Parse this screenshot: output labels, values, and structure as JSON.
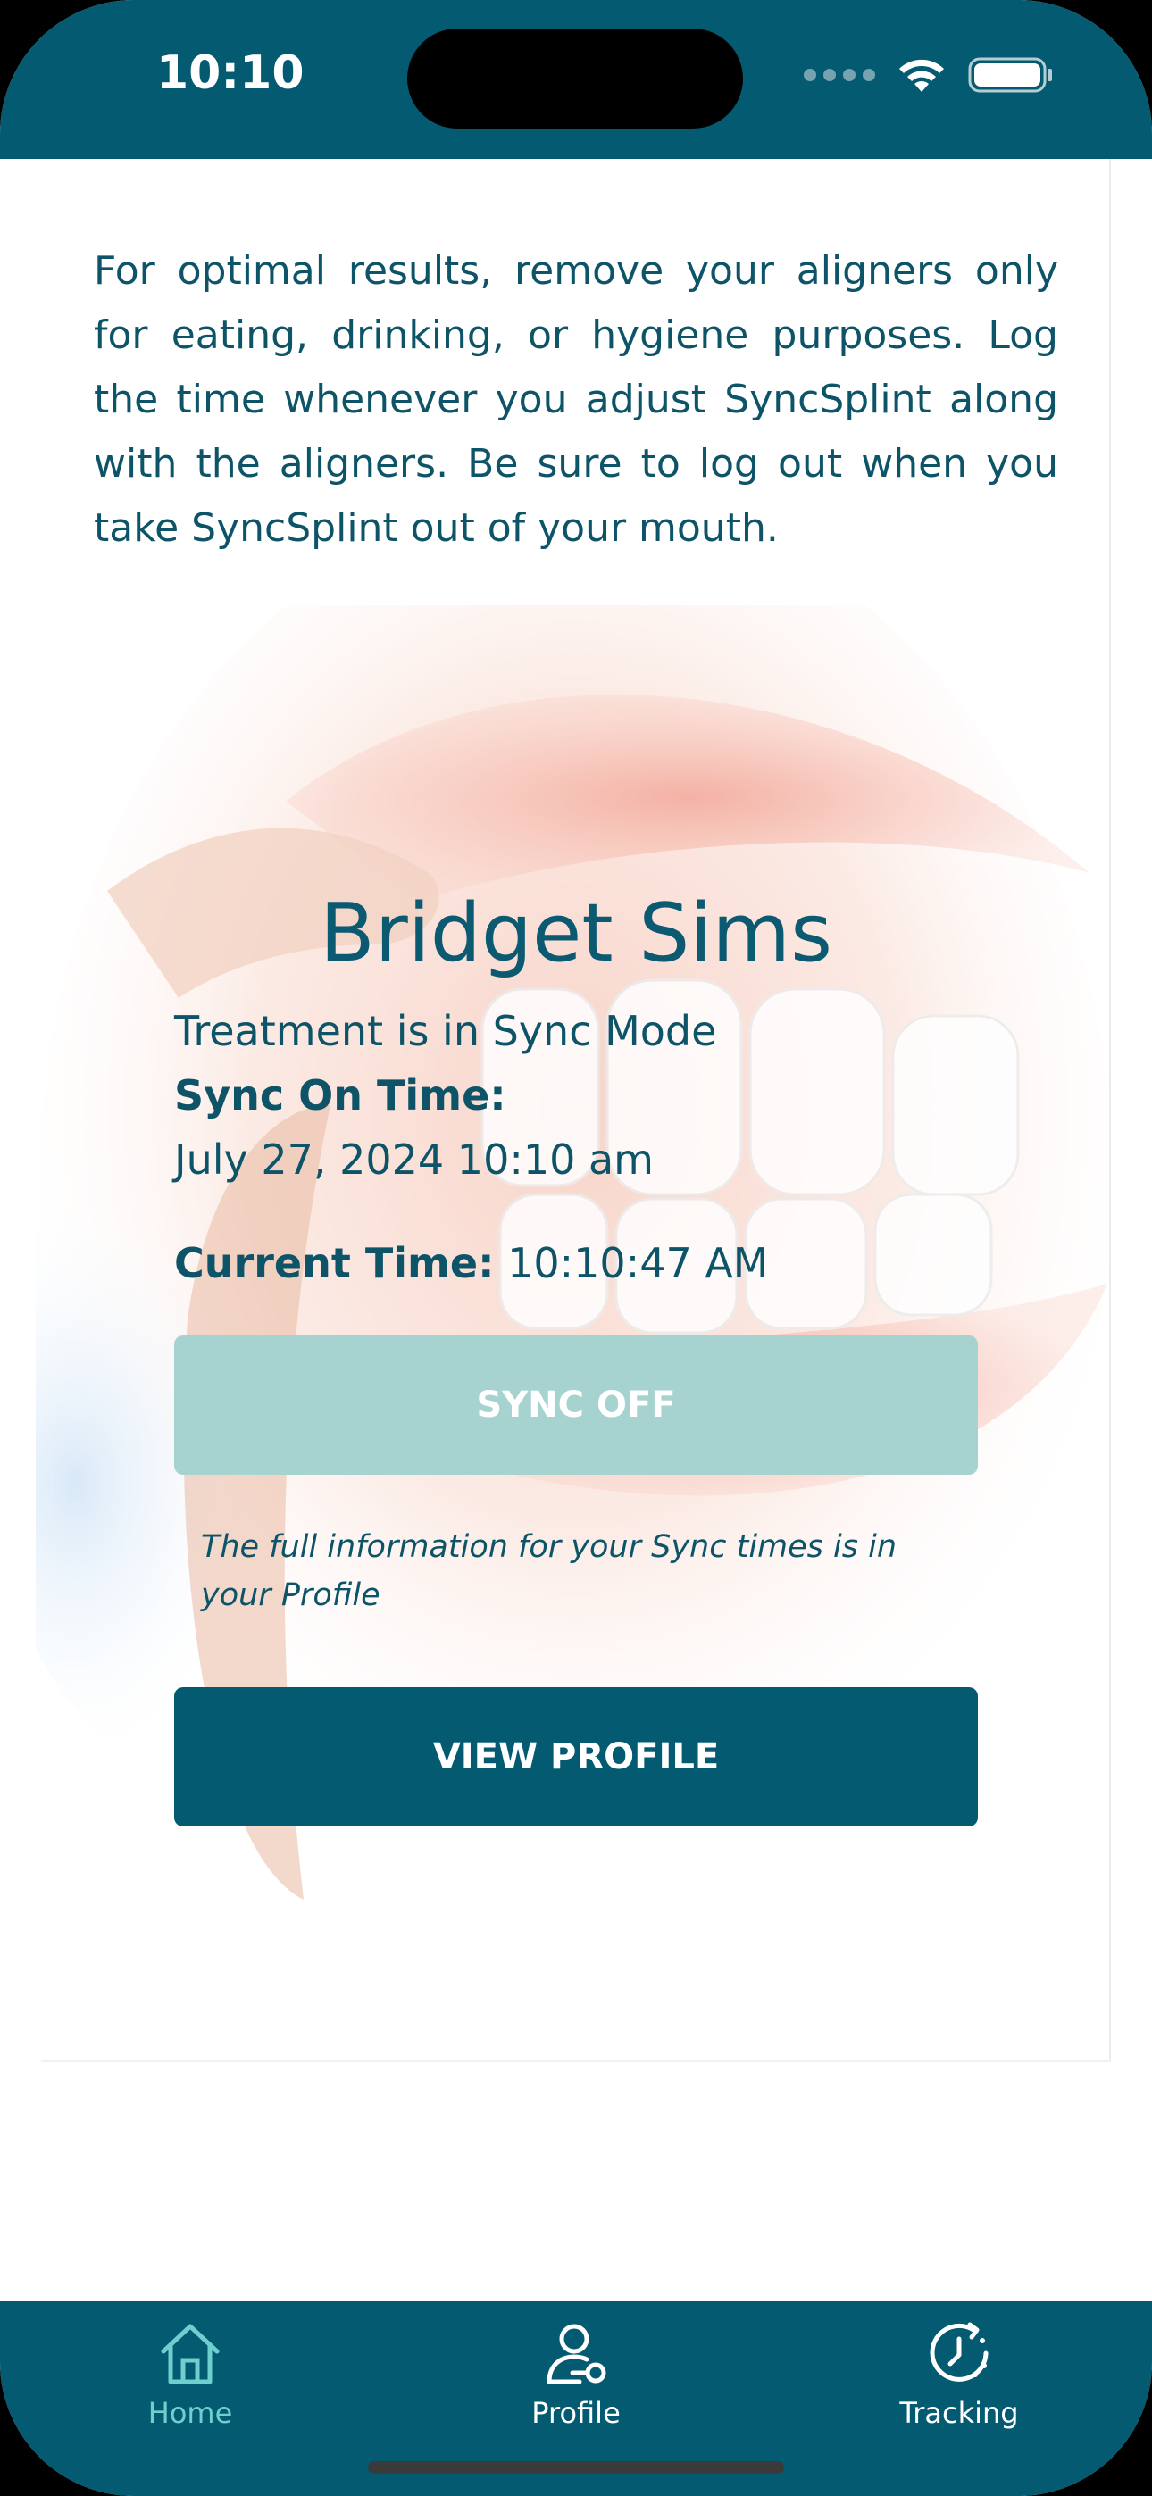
{
  "status_bar": {
    "time": "10:10",
    "icons": [
      "cellular-signal-icon",
      "wifi-icon",
      "battery-icon"
    ]
  },
  "intro": {
    "text": "For optimal results, remove your aligners only for eating, drinking, or hygiene purposes. Log the time whenever you adjust SyncSplint along with the aligners. Be sure to log out when you take SyncSplint out of your mouth."
  },
  "patient": {
    "name": "Bridget Sims",
    "treatment_status": "Treatment is in Sync Mode",
    "sync_on_label": "Sync On Time:",
    "sync_on_value": "July 27, 2024 10:10 am",
    "current_time_label": "Current Time:",
    "current_time_value": "10:10:47 AM"
  },
  "actions": {
    "sync_button": "SYNC OFF",
    "info_note": "The full information for your Sync times is in your Profile",
    "profile_button": "VIEW PROFILE"
  },
  "tabs": [
    {
      "label": "Home",
      "icon": "home-icon",
      "active": true
    },
    {
      "label": "Profile",
      "icon": "profile-icon",
      "active": false
    },
    {
      "label": "Tracking",
      "icon": "clock-icon",
      "active": false
    }
  ],
  "colors": {
    "primary": "#045a70",
    "text": "#0d5468",
    "sync_button": "#a6d3d0",
    "active_tab": "#6fcfcf",
    "background": "#ffffff"
  }
}
